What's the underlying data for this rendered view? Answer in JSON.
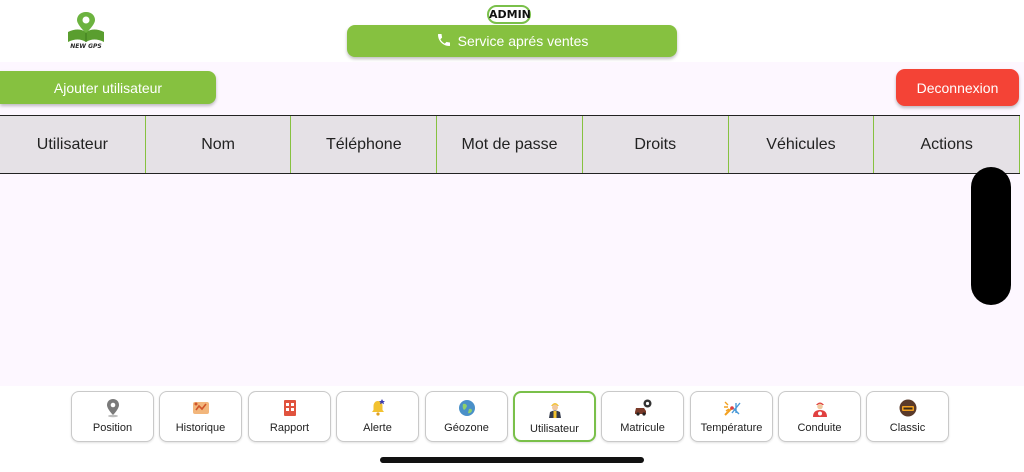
{
  "header": {
    "logo_text": "NEW GPS",
    "role_badge": "ADMIN",
    "service_button_label": "Service aprés ventes",
    "service_icon": "phone-icon"
  },
  "toolbar": {
    "add_user_label": "Ajouter utilisateur",
    "logout_label": "Deconnexion"
  },
  "table": {
    "columns": [
      "Utilisateur",
      "Nom",
      "Téléphone",
      "Mot de passe",
      "Droits",
      "Véhicules",
      "Actions"
    ],
    "rows": []
  },
  "nav": {
    "active": "Utilisateur",
    "items": [
      {
        "label": "Position",
        "icon": "map-pin-icon"
      },
      {
        "label": "Historique",
        "icon": "history-icon"
      },
      {
        "label": "Rapport",
        "icon": "report-icon"
      },
      {
        "label": "Alerte",
        "icon": "bell-icon"
      },
      {
        "label": "Géozone",
        "icon": "globe-icon"
      },
      {
        "label": "Utilisateur",
        "icon": "user-icon"
      },
      {
        "label": "Matricule",
        "icon": "car-gear-icon"
      },
      {
        "label": "Température",
        "icon": "temperature-icon"
      },
      {
        "label": "Conduite",
        "icon": "driver-icon"
      },
      {
        "label": "Classic",
        "icon": "classic-icon"
      }
    ]
  },
  "colors": {
    "accent": "#86c140",
    "danger": "#f44336",
    "header_bg": "#e5e1e6",
    "content_bg": "#fdf7ff"
  }
}
